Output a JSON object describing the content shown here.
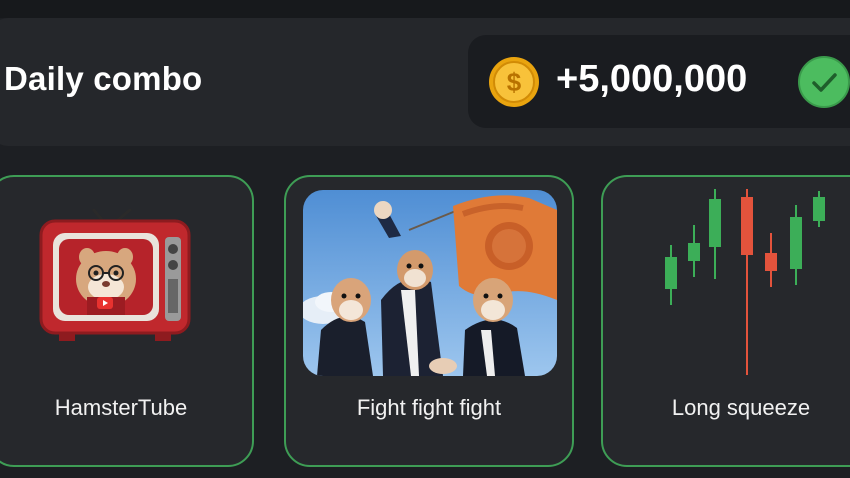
{
  "header": {
    "title": "Daily combo",
    "reward_amount": "+5,000,000",
    "coin_icon": "coin-icon",
    "status_icon": "check-circle-icon"
  },
  "cards": [
    {
      "label": "HamsterTube",
      "image": "hamster-tv-image"
    },
    {
      "label": "Fight fight fight",
      "image": "hamsters-flag-image"
    },
    {
      "label": "Long squeeze",
      "image": "candlestick-chart-image"
    }
  ],
  "colors": {
    "background": "#1d1f23",
    "panel": "#25272b",
    "card_border": "#3e9d55",
    "check": "#4cbc5f",
    "coin": "#f5b21c"
  }
}
